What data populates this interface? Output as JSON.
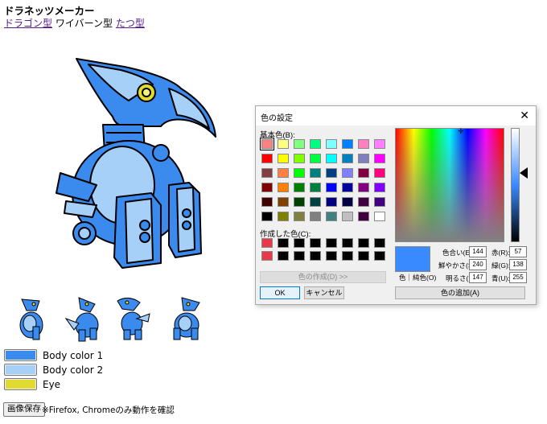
{
  "title": "ドラネッツメーカー",
  "nav": {
    "link1": "ドラゴン型",
    "current": "ワイバーン型",
    "link2": "たつ型"
  },
  "swatches": [
    {
      "label": "Body color 1",
      "color": "#3b8aee"
    },
    {
      "label": "Body color 2",
      "color": "#a6d0f7"
    },
    {
      "label": "Eye",
      "color": "#e0db2e"
    }
  ],
  "save_button": "画像保存",
  "note": "※Firefox, Chromeのみ動作を確認",
  "dialog": {
    "title": "色の設定",
    "close": "✕",
    "basic_colors_label": "基本色(B):",
    "custom_colors_label": "作成した色(C):",
    "define_button": "色の作成(D) >>",
    "ok": "OK",
    "cancel": "キャンセル",
    "preview_label": "色｜純色(O)",
    "add_button": "色の追加(A)",
    "fields": {
      "hue_label": "色合い(E):",
      "hue": "144",
      "sat_label": "鮮やかさ(S):",
      "sat": "240",
      "lum_label": "明るさ(L):",
      "lum": "147",
      "red_label": "赤(R):",
      "red": "57",
      "green_label": "緑(G):",
      "green": "138",
      "blue_label": "青(U):",
      "blue": "255"
    },
    "current_color": "#398aff",
    "basic_colors": [
      "#ff8080",
      "#ffff80",
      "#80ff80",
      "#00ff80",
      "#80ffff",
      "#0080ff",
      "#ff80c0",
      "#ff80ff",
      "#ff0000",
      "#ffff00",
      "#80ff00",
      "#00ff40",
      "#00ffff",
      "#0080c0",
      "#8080c0",
      "#ff00ff",
      "#804040",
      "#ff8040",
      "#00ff00",
      "#008080",
      "#004080",
      "#8080ff",
      "#800040",
      "#ff0080",
      "#800000",
      "#ff8000",
      "#008000",
      "#008040",
      "#0000ff",
      "#0000a0",
      "#800080",
      "#8000ff",
      "#400000",
      "#804000",
      "#004000",
      "#004040",
      "#000080",
      "#000040",
      "#400040",
      "#400080",
      "#000000",
      "#808000",
      "#808040",
      "#808080",
      "#408080",
      "#c0c0c0",
      "#400040",
      "#ffffff"
    ],
    "custom_colors": [
      "#e8394a",
      "#000000",
      "#000000",
      "#000000",
      "#000000",
      "#000000",
      "#000000",
      "#000000",
      "#e8394a",
      "#000000",
      "#000000",
      "#000000",
      "#000000",
      "#000000",
      "#000000",
      "#000000"
    ]
  }
}
